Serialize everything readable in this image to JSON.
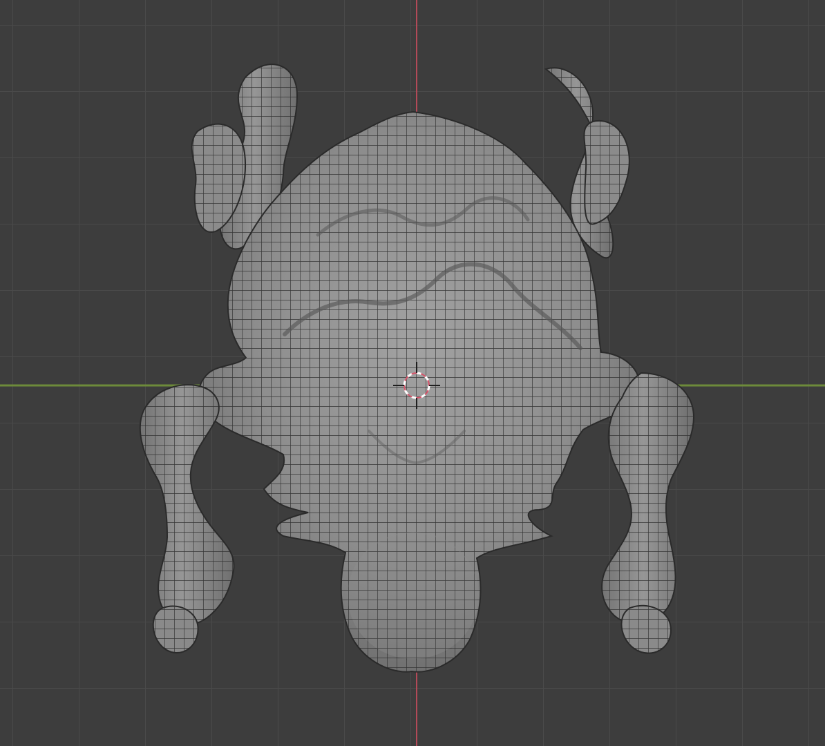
{
  "viewport": {
    "view": "3D Viewport",
    "background_color": "#3d3d3d",
    "grid_color": "#4a4a4a",
    "x_axis_color": "#6d8b3a",
    "y_axis_color": "#b34a58",
    "cursor_color": "#d6546a",
    "mesh_fill_color": "#8b8b8b",
    "wire_color": "#2b2b2b",
    "mesh_name": "",
    "display": "wireframe-on-shaded"
  },
  "icons": {
    "cursor": "3d-cursor-icon",
    "mesh": "mesh-icon"
  }
}
